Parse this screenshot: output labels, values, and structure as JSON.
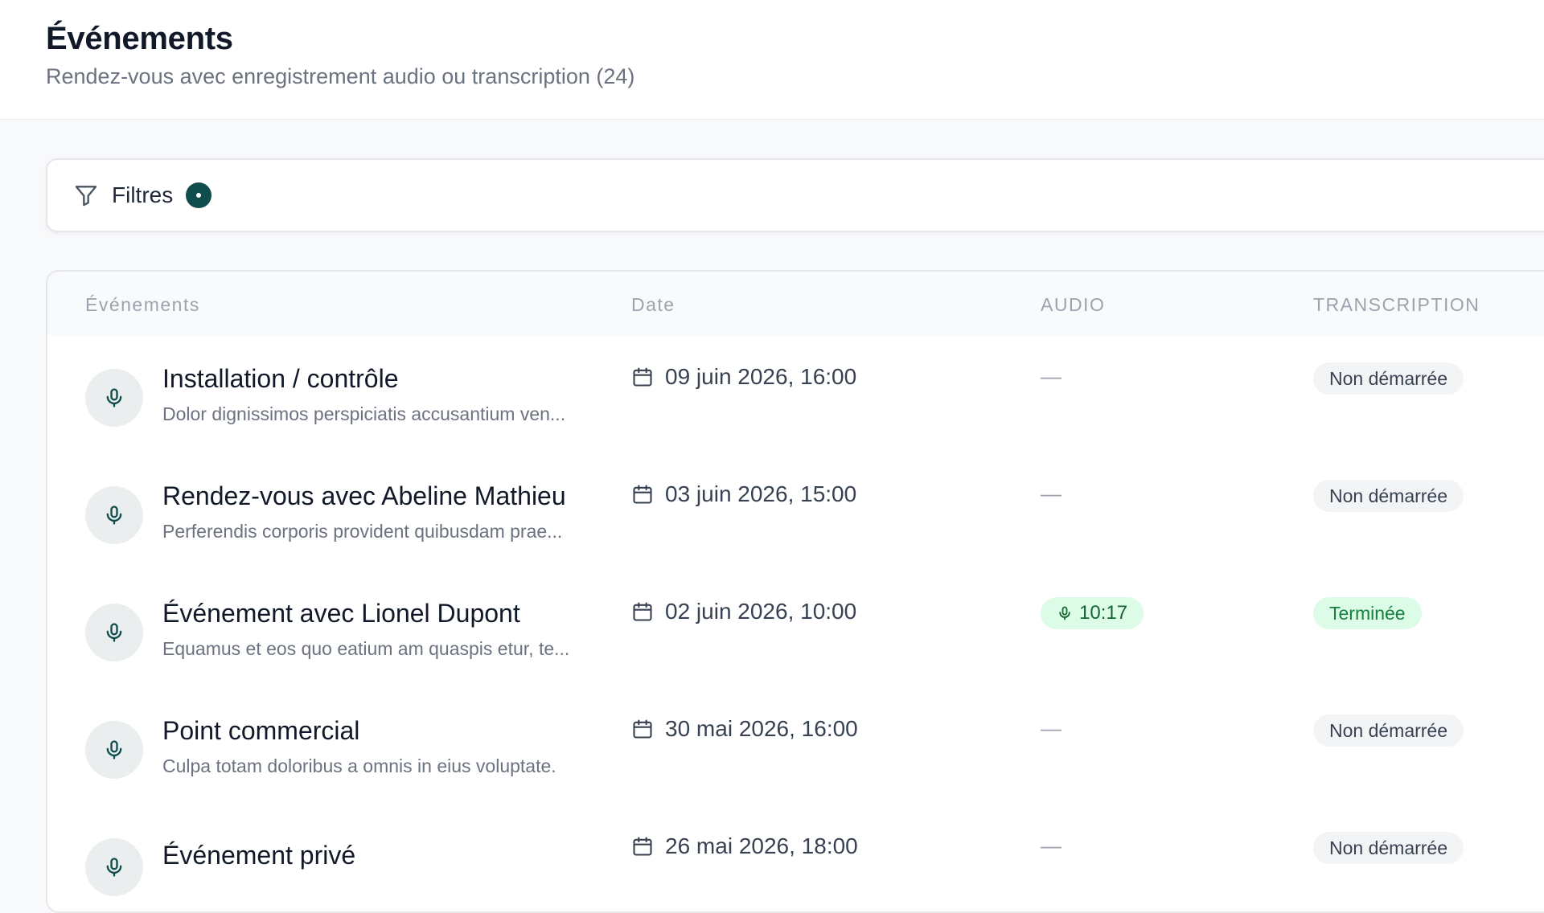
{
  "header": {
    "title": "Événements",
    "subtitle": "Rendez-vous avec enregistrement audio ou transcription (24)"
  },
  "filters": {
    "label": "Filtres",
    "icon": "filter-icon",
    "active_indicator": true
  },
  "table": {
    "columns": {
      "events": "Événements",
      "date": "Date",
      "audio": "AUDIO",
      "transcription": "TRANSCRIPTION"
    },
    "rows": [
      {
        "title": "Installation / contrôle",
        "description": "Dolor dignissimos perspiciatis accusantium ven...",
        "date": "09 juin 2026, 16:00",
        "audio": "—",
        "status": "Non démarrée"
      },
      {
        "title": "Rendez-vous avec Abeline Mathieu",
        "description": "Perferendis corporis provident quibusdam prae...",
        "date": "03 juin 2026, 15:00",
        "audio": "—",
        "status": "Non démarrée"
      },
      {
        "title": "Événement avec Lionel Dupont",
        "description": "Equamus et eos quo eatium am quaspis etur, te...",
        "date": "02 juin 2026, 10:00",
        "audio": "10:17",
        "status": "Terminée"
      },
      {
        "title": "Point commercial",
        "description": "Culpa totam doloribus a omnis in eius voluptate.",
        "date": "30 mai 2026, 16:00",
        "audio": "—",
        "status": "Non démarrée"
      },
      {
        "title": "Événement privé",
        "description": "",
        "date": "26 mai 2026, 18:00",
        "audio": "—",
        "status": "Non démarrée"
      }
    ]
  },
  "colors": {
    "accent": "#0f4c4c",
    "success_bg": "#dcfce7",
    "success_text": "#15803d",
    "neutral_bg": "#f3f4f6"
  },
  "icons": {
    "row_avatar": "microphone-icon",
    "date": "calendar-icon",
    "audio": "microphone-icon"
  }
}
